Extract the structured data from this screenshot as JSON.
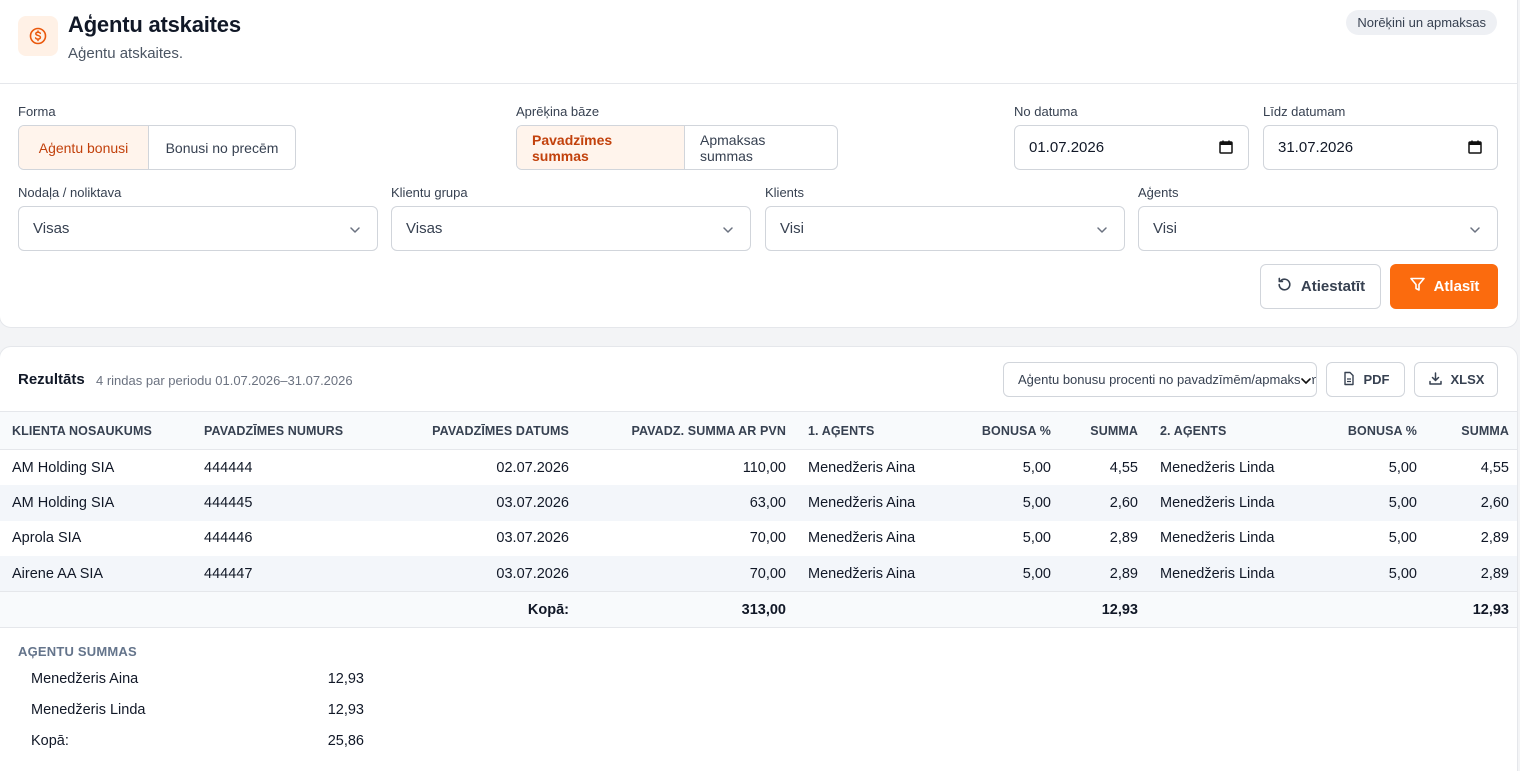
{
  "header": {
    "title": "Aģentu atskaites",
    "subtitle": "Aģentu atskaites.",
    "badge": "Norēķini un apmaksas",
    "icon": "dollar-circle-icon",
    "accent": "#fb6b0e"
  },
  "filters": {
    "forma": {
      "label": "Forma",
      "options": [
        "Aģentu bonusi",
        "Bonusi no precēm"
      ],
      "selected": "Aģentu bonusi"
    },
    "bazes": {
      "label": "Aprēķina bāze",
      "options": [
        "Pavadzīmes summas",
        "Apmaksas summas"
      ],
      "selected": "Pavadzīmes summas"
    },
    "date_from": {
      "label": "No datuma",
      "value": "01.07.2026"
    },
    "date_to": {
      "label": "Līdz datumam",
      "value": "31.07.2026"
    },
    "nodala": {
      "label": "Nodaļa / noliktava",
      "value": "Visas"
    },
    "klientu_grupa": {
      "label": "Klientu grupa",
      "value": "Visas"
    },
    "klients": {
      "label": "Klients",
      "value": "Visi"
    },
    "agents": {
      "label": "Aģents",
      "value": "Visi"
    },
    "reset_label": "Atiestatīt",
    "apply_label": "Atlasīt"
  },
  "results": {
    "title": "Rezultāts",
    "meta": "4 rindas par periodu 01.07.2026–31.07.2026",
    "report_select": "Aģentu bonusu procenti no pavadzīmēm/apmaksām",
    "pdf_label": "PDF",
    "xlsx_label": "XLSX",
    "columns": [
      "Klienta nosaukums",
      "Pavadzīmes numurs",
      "Pavadzīmes datums",
      "Pavadz. summa ar PVN",
      "1. aģents",
      "Bonusa %",
      "Summa",
      "2. aģents",
      "Bonusa %",
      "Summa"
    ],
    "rows": [
      [
        "AM Holding SIA",
        "444444",
        "02.07.2026",
        "110,00",
        "Menedžeris Aina",
        "5,00",
        "4,55",
        "Menedžeris Linda",
        "5,00",
        "4,55"
      ],
      [
        "AM Holding SIA",
        "444445",
        "03.07.2026",
        "63,00",
        "Menedžeris Aina",
        "5,00",
        "2,60",
        "Menedžeris Linda",
        "5,00",
        "2,60"
      ],
      [
        "Aprola SIA",
        "444446",
        "03.07.2026",
        "70,00",
        "Menedžeris Aina",
        "5,00",
        "2,89",
        "Menedžeris Linda",
        "5,00",
        "2,89"
      ],
      [
        "Airene AA SIA",
        "444447",
        "03.07.2026",
        "70,00",
        "Menedžeris Aina",
        "5,00",
        "2,89",
        "Menedžeris Linda",
        "5,00",
        "2,89"
      ]
    ],
    "total": {
      "label": "Kopā:",
      "sum_pvn": "313,00",
      "sum_1": "12,93",
      "sum_2": "12,93"
    }
  },
  "agent_sums": {
    "title": "AĢENTU SUMMAS",
    "items": [
      {
        "name": "Menedžeris Aina",
        "value": "12,93"
      },
      {
        "name": "Menedžeris Linda",
        "value": "12,93"
      },
      {
        "name": "Kopā:",
        "value": "25,86"
      }
    ]
  }
}
